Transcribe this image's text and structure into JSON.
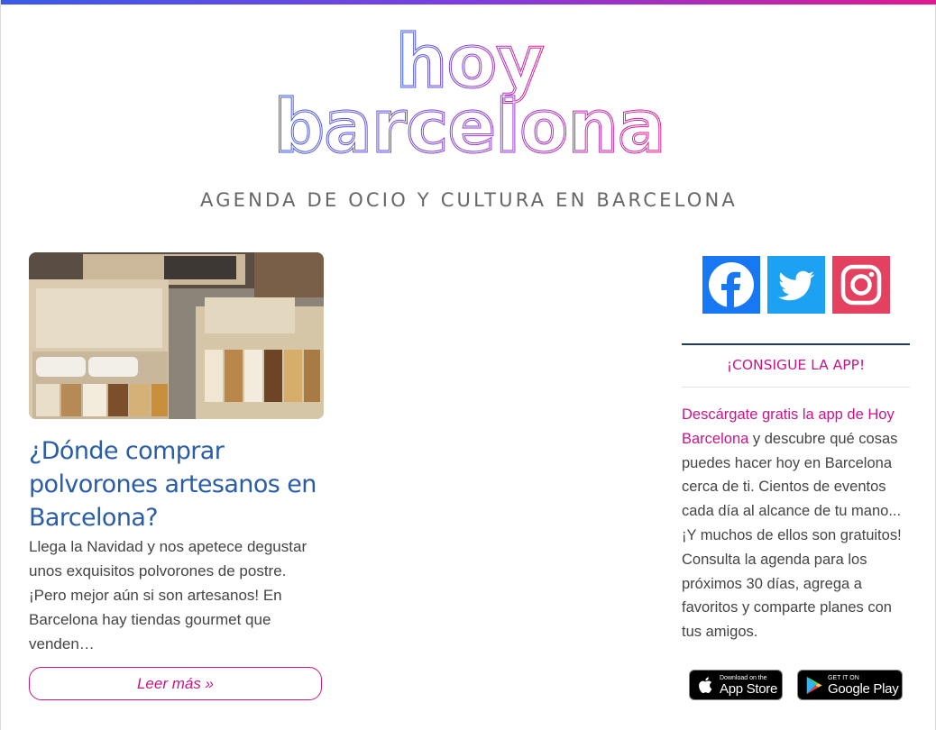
{
  "site": {
    "logo_line1": "hoy",
    "logo_line2": "barcelona",
    "tagline": "AGENDA DE OCIO Y CULTURA EN BARCELONA"
  },
  "colors": {
    "brand_magenta": "#c7168a",
    "title_blue": "#2a5da8",
    "gradient_start": "#3a5be8",
    "gradient_end": "#e0198f",
    "facebook": "#1877f2",
    "twitter": "#1da1f2",
    "instagram": "#e4405f"
  },
  "post": {
    "image_icon": "polvorones-photo",
    "title": "¿Dónde comprar polvorones artesanos en Barcelona?",
    "excerpt": "Llega la Navidad y nos apetece degustar unos exquisitos polvorones de postre. ¡Pero mejor aún si son artesanos! En Barcelona hay tiendas gourmet que venden…",
    "read_more": "Leer más »"
  },
  "sidebar": {
    "social": [
      {
        "name": "facebook",
        "icon": "facebook-icon"
      },
      {
        "name": "twitter",
        "icon": "twitter-icon"
      },
      {
        "name": "instagram",
        "icon": "instagram-icon"
      }
    ],
    "widget_title": "¡CONSIGUE LA APP!",
    "widget_link": "Descárgate gratis la app de Hoy Barcelona",
    "widget_text": " y descubre qué cosas puedes hacer hoy en Barcelona cerca de ti. Cientos de eventos cada día al alcance de tu mano... ¡Y muchos de ellos son gratuitos! Consulta la agenda para los próximos 30 días, agrega a favoritos y comparte planes con tus amigos.",
    "app_store": {
      "small": "Download on the",
      "big": "App Store"
    },
    "google_play": {
      "small": "GET IT ON",
      "big": "Google Play"
    }
  }
}
